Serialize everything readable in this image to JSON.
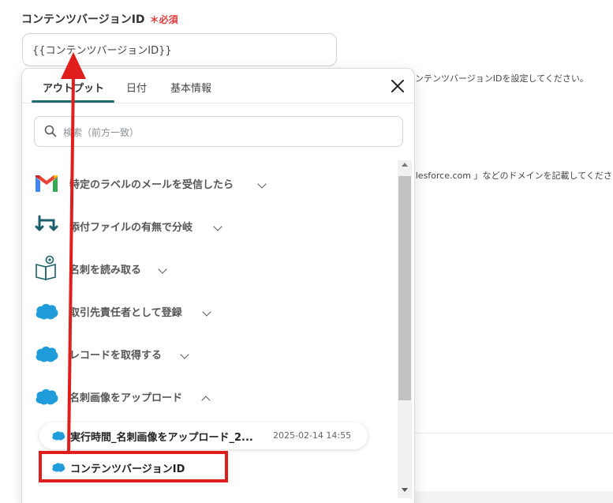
{
  "field": {
    "label": "コンテンツバージョンID",
    "required_mark": "＊必須",
    "value": "{{コンテンツバージョンID}}"
  },
  "background": {
    "help_text_1": "ンテンツバージョンIDを設定してください。",
    "help_text_2": "alesforce.com 」などのドメインを記載してください"
  },
  "popup": {
    "tabs": [
      {
        "label": "アウトプット",
        "active": true
      },
      {
        "label": "日付",
        "active": false
      },
      {
        "label": "基本情報",
        "active": false
      }
    ],
    "search_placeholder": "検索（前方一致）",
    "steps": [
      {
        "label": "特定のラベルのメールを受信したら",
        "icon": "gmail-icon",
        "expanded": false
      },
      {
        "label": "添付ファイルの有無で分岐",
        "icon": "branch-icon",
        "expanded": false
      },
      {
        "label": "名刺を読み取る",
        "icon": "ocr-book-icon",
        "expanded": false
      },
      {
        "label": "取引先責任者として登録",
        "icon": "salesforce-icon",
        "expanded": false
      },
      {
        "label": "レコードを取得する",
        "icon": "salesforce-icon",
        "expanded": false
      },
      {
        "label": "名刺画像をアップロード",
        "icon": "salesforce-icon",
        "expanded": true
      }
    ],
    "outputs": [
      {
        "label": "実行時間_名刺画像をアップロード_2...",
        "value": "2025-02-14 14:55"
      },
      {
        "label": "コンテンツバージョンID",
        "value": ""
      }
    ]
  },
  "colors": {
    "accent_tab": "#1f6b6b",
    "required": "#e53a3a",
    "annotation_red": "#e01e1e",
    "salesforce_blue": "#1f9cd9"
  }
}
